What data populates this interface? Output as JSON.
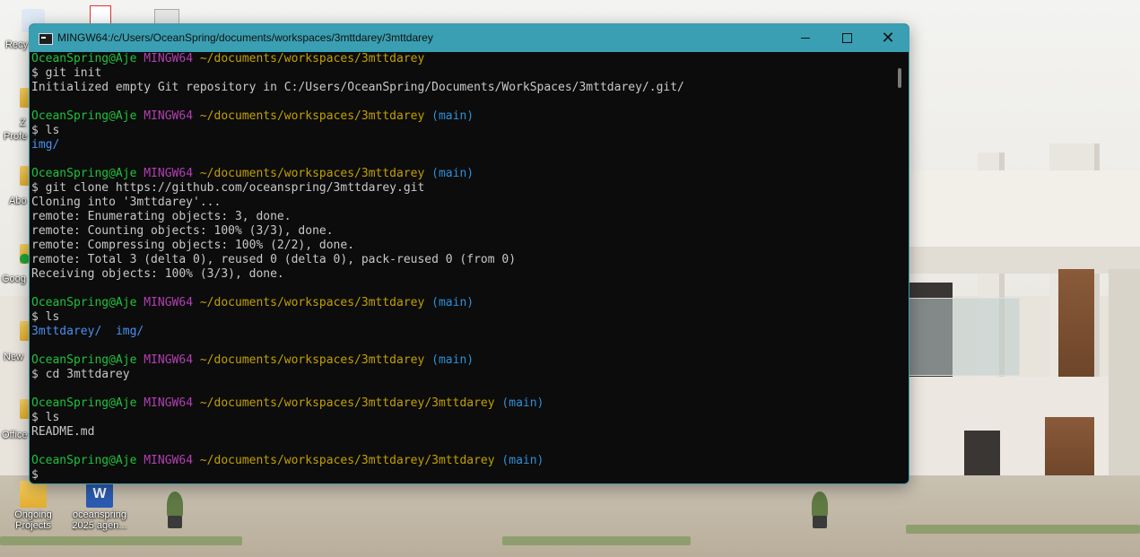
{
  "window": {
    "title": "MINGW64:/c/Users/OceanSpring/documents/workspaces/3mttdarey/3mttdarey",
    "controls": {
      "minimize_icon": "minimize-icon",
      "maximize_icon": "maximize-icon",
      "close_label": "✕"
    }
  },
  "terminal": {
    "colors": {
      "user": "#1fc23a",
      "host": "#b23fb3",
      "path": "#c2a000",
      "branch": "#2f8fd8",
      "text": "#c8c8c8",
      "dir": "#4a8ff0",
      "background": "#0c0c0c"
    },
    "lines": [
      {
        "type": "prompt",
        "user": "OceanSpring@Aje",
        "host": "MINGW64",
        "path": "~/documents/workspaces/3mttdarey",
        "branch": ""
      },
      {
        "type": "cmd",
        "text": "$ git init"
      },
      {
        "type": "out",
        "text": "Initialized empty Git repository in C:/Users/OceanSpring/Documents/WorkSpaces/3mttdarey/.git/"
      },
      {
        "type": "blank",
        "text": ""
      },
      {
        "type": "prompt",
        "user": "OceanSpring@Aje",
        "host": "MINGW64",
        "path": "~/documents/workspaces/3mttdarey",
        "branch": "(main)"
      },
      {
        "type": "cmd",
        "text": "$ ls"
      },
      {
        "type": "dirs",
        "items": [
          "img/"
        ]
      },
      {
        "type": "blank",
        "text": ""
      },
      {
        "type": "prompt",
        "user": "OceanSpring@Aje",
        "host": "MINGW64",
        "path": "~/documents/workspaces/3mttdarey",
        "branch": "(main)"
      },
      {
        "type": "cmd",
        "text": "$ git clone https://github.com/oceanspring/3mttdarey.git"
      },
      {
        "type": "out",
        "text": "Cloning into '3mttdarey'..."
      },
      {
        "type": "out",
        "text": "remote: Enumerating objects: 3, done."
      },
      {
        "type": "out",
        "text": "remote: Counting objects: 100% (3/3), done."
      },
      {
        "type": "out",
        "text": "remote: Compressing objects: 100% (2/2), done."
      },
      {
        "type": "out",
        "text": "remote: Total 3 (delta 0), reused 0 (delta 0), pack-reused 0 (from 0)"
      },
      {
        "type": "out",
        "text": "Receiving objects: 100% (3/3), done."
      },
      {
        "type": "blank",
        "text": ""
      },
      {
        "type": "prompt",
        "user": "OceanSpring@Aje",
        "host": "MINGW64",
        "path": "~/documents/workspaces/3mttdarey",
        "branch": "(main)"
      },
      {
        "type": "cmd",
        "text": "$ ls"
      },
      {
        "type": "dirs",
        "items": [
          "3mttdarey/",
          "img/"
        ]
      },
      {
        "type": "blank",
        "text": ""
      },
      {
        "type": "prompt",
        "user": "OceanSpring@Aje",
        "host": "MINGW64",
        "path": "~/documents/workspaces/3mttdarey",
        "branch": "(main)"
      },
      {
        "type": "cmd",
        "text": "$ cd 3mttdarey"
      },
      {
        "type": "blank",
        "text": ""
      },
      {
        "type": "prompt",
        "user": "OceanSpring@Aje",
        "host": "MINGW64",
        "path": "~/documents/workspaces/3mttdarey/3mttdarey",
        "branch": "(main)"
      },
      {
        "type": "cmd",
        "text": "$ ls"
      },
      {
        "type": "out",
        "text": "README.md"
      },
      {
        "type": "blank",
        "text": ""
      },
      {
        "type": "prompt",
        "user": "OceanSpring@Aje",
        "host": "MINGW64",
        "path": "~/documents/workspaces/3mttdarey/3mttdarey",
        "branch": "(main)"
      },
      {
        "type": "cmd",
        "text": "$ "
      }
    ]
  },
  "desktop": {
    "icons": [
      {
        "name": "ongoing-projects-folder",
        "label_line1": "Ongoing",
        "label_line2": "Projects",
        "icon": "folder-icon"
      },
      {
        "name": "oceanspring-agenda-doc",
        "label_line1": "oceanspring",
        "label_line2": "2025 agen...",
        "icon": "word-document-icon"
      }
    ],
    "partial_labels": [
      "Recy",
      "Z",
      "Profe",
      "Abo",
      "Goog",
      "New",
      "Office"
    ]
  }
}
